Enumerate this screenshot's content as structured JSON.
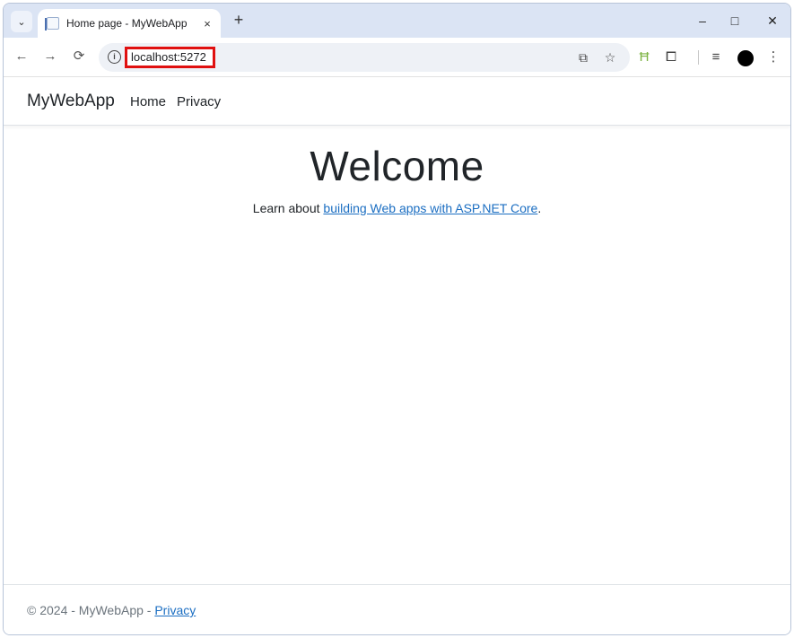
{
  "browser": {
    "tab_title": "Home page - MyWebApp",
    "tab_close": "×",
    "new_tab": "+",
    "url": "localhost:5272",
    "window_controls": {
      "minimize": "–",
      "maximize": "□",
      "close": "✕"
    },
    "icons": {
      "tab_search": "chevron-down-icon",
      "back": "arrow-left-icon",
      "forward": "arrow-right-icon",
      "reload": "reload-icon",
      "site_info": "info-icon",
      "translate": "translate-icon",
      "bookmark": "star-icon",
      "extension_green": "ladder-icon",
      "extensions": "puzzle-icon",
      "reading_list": "media-list-icon",
      "profile": "profile-icon",
      "menu": "kebab-menu-icon"
    },
    "accent_color": "#e01010"
  },
  "navbar": {
    "brand": "MyWebApp",
    "links": [
      "Home",
      "Privacy"
    ]
  },
  "main": {
    "heading": "Welcome",
    "lead_prefix": "Learn about ",
    "lead_link": "building Web apps with ASP.NET Core",
    "lead_suffix": "."
  },
  "footer": {
    "prefix": "© 2024 - MyWebApp - ",
    "link": "Privacy"
  }
}
